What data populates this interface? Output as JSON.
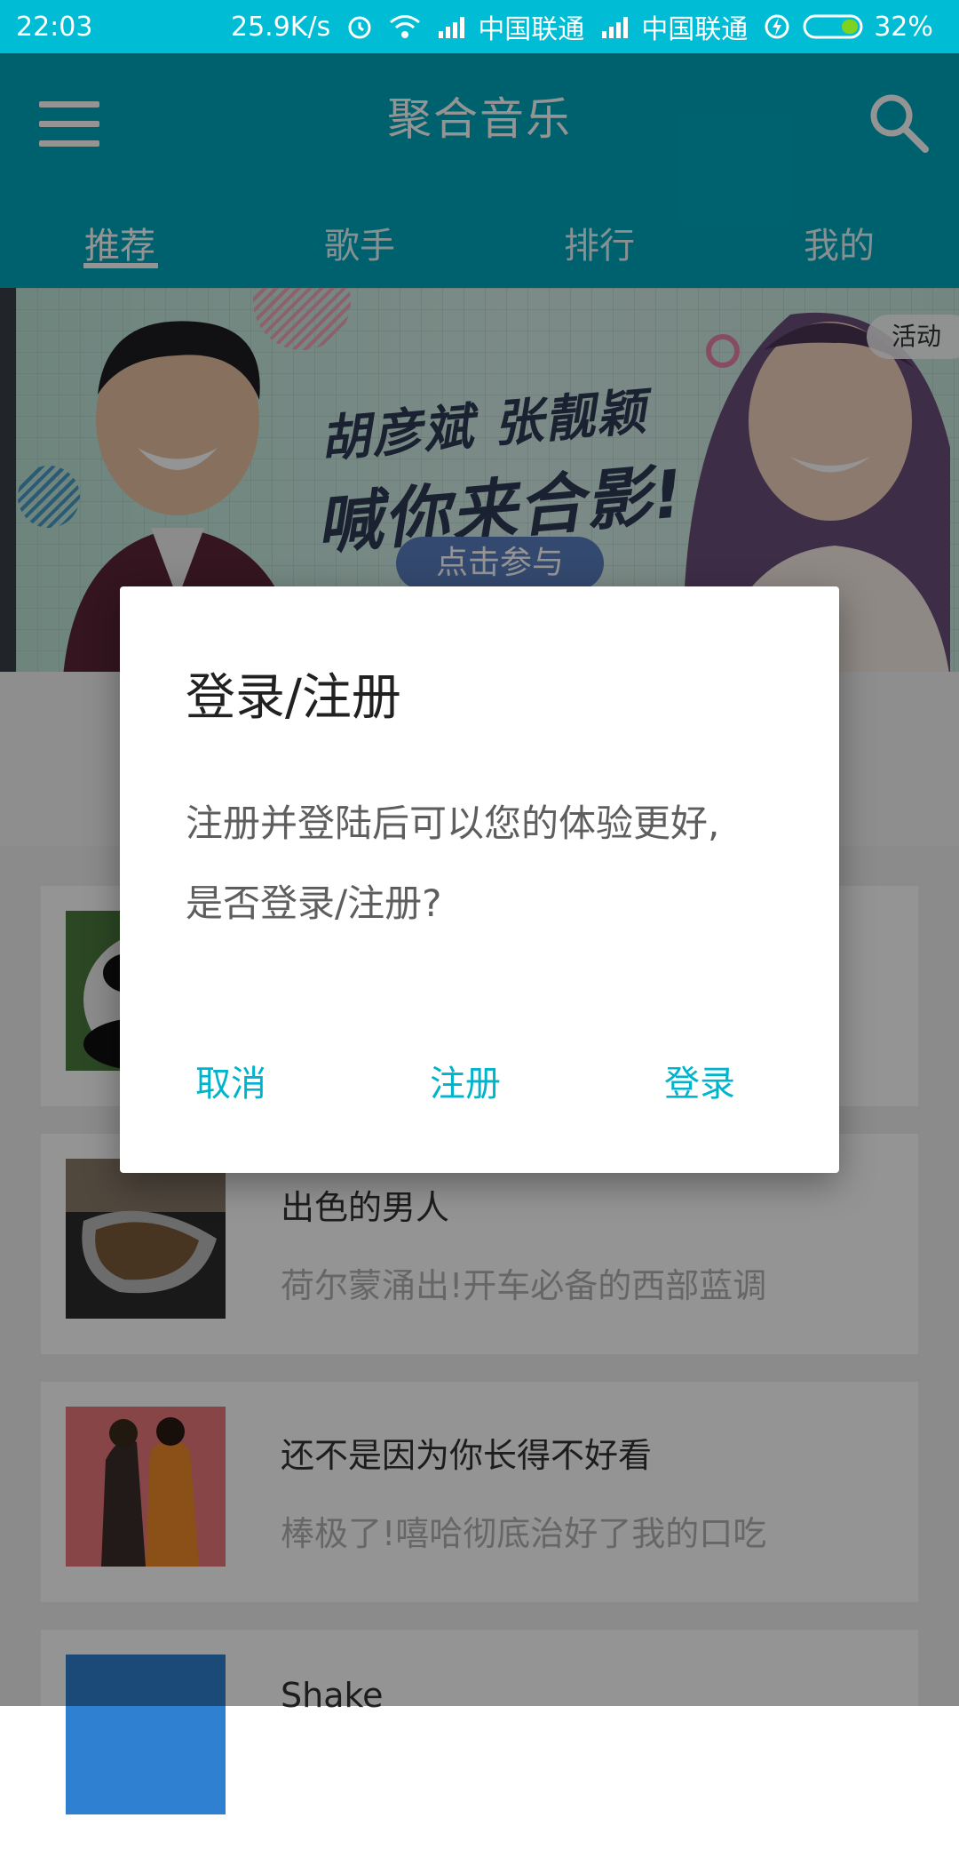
{
  "status_bar": {
    "time": "22:03",
    "net_speed": "25.9K/s",
    "carrier_1": "中国联通",
    "carrier_2": "中国联通",
    "battery": "32%"
  },
  "toolbar": {
    "title": "聚合音乐",
    "menu_icon": "menu-icon",
    "search_icon": "search-icon"
  },
  "tabs": [
    {
      "label": "推荐",
      "active": true
    },
    {
      "label": "歌手",
      "active": false
    },
    {
      "label": "排行",
      "active": false
    },
    {
      "label": "我的",
      "active": false
    }
  ],
  "banner": {
    "headline_1": "胡彦斌 张靓颖",
    "headline_2": "喊你来合影!",
    "cta": "点击参与",
    "badge": "活动"
  },
  "playlists": [
    {
      "title": "",
      "subtitle": ""
    },
    {
      "title": "出色的男人",
      "subtitle": "荷尔蒙涌出!开车必备的西部蓝调"
    },
    {
      "title": "还不是因为你长得不好看",
      "subtitle": "棒极了!嘻哈彻底治好了我的口吃"
    },
    {
      "title": "Shake",
      "subtitle": ""
    }
  ],
  "dialog": {
    "title": "登录/注册",
    "message": "注册并登陆后可以您的体验更好, 是否登录/注册?",
    "cancel": "取消",
    "register": "注册",
    "login": "登录"
  },
  "colors": {
    "primary": "#00a8bd",
    "status_bar": "#00bcd4",
    "dialog_button": "#00b4cc"
  }
}
